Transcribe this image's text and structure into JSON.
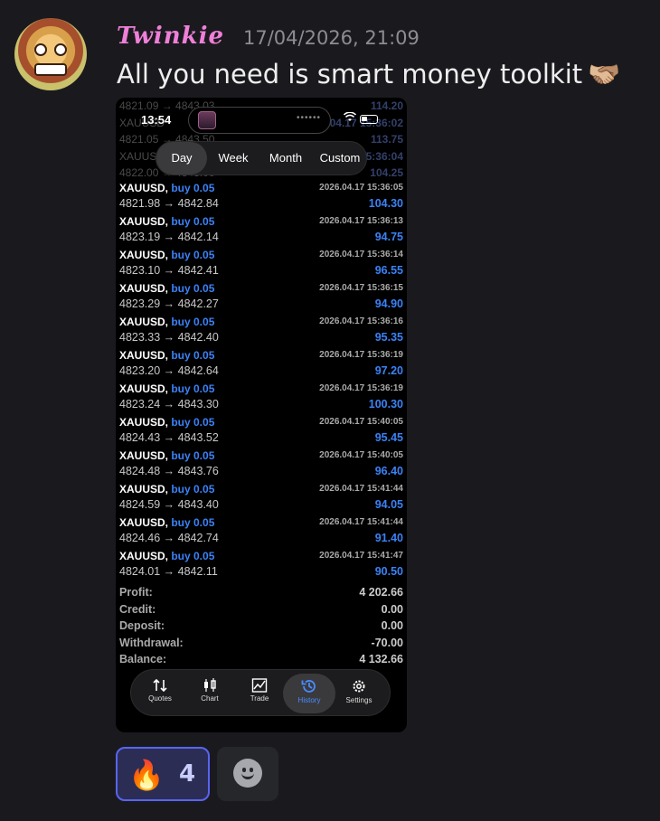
{
  "author": {
    "name": "Twinkie",
    "timestamp": "17/04/2026, 21:09"
  },
  "message": {
    "text": "All you need is smart money toolkit",
    "emoji": "🫱🏼‍🫲🏽"
  },
  "screenshot": {
    "clock": "13:54",
    "island_dots": "••••••",
    "ghost_rows": [
      {
        "text": "4821.09 → 4843.03",
        "value": "114.20"
      },
      {
        "text": "XAUUSD",
        "value": "2026.04.17 15:36:02"
      },
      {
        "text": "4821.05 → 4843.50",
        "value": "113.75"
      },
      {
        "text": "XAUUSD",
        "value": "2026.04.17 15:36:04"
      },
      {
        "text": "4822.00 → 4843.06",
        "value": "104.25"
      }
    ],
    "periods": [
      "Day",
      "Week",
      "Month",
      "Custom"
    ],
    "trades": [
      {
        "symbol": "XAUUSD,",
        "side": "buy 0.05",
        "date": "2026.04.17 15:36:05",
        "prices": "4821.98 → 4842.84",
        "profit": "104.30"
      },
      {
        "symbol": "XAUUSD,",
        "side": "buy 0.05",
        "date": "2026.04.17 15:36:13",
        "prices": "4823.19 → 4842.14",
        "profit": "94.75"
      },
      {
        "symbol": "XAUUSD,",
        "side": "buy 0.05",
        "date": "2026.04.17 15:36:14",
        "prices": "4823.10 → 4842.41",
        "profit": "96.55"
      },
      {
        "symbol": "XAUUSD,",
        "side": "buy 0.05",
        "date": "2026.04.17 15:36:15",
        "prices": "4823.29 → 4842.27",
        "profit": "94.90"
      },
      {
        "symbol": "XAUUSD,",
        "side": "buy 0.05",
        "date": "2026.04.17 15:36:16",
        "prices": "4823.33 → 4842.40",
        "profit": "95.35"
      },
      {
        "symbol": "XAUUSD,",
        "side": "buy 0.05",
        "date": "2026.04.17 15:36:19",
        "prices": "4823.20 → 4842.64",
        "profit": "97.20"
      },
      {
        "symbol": "XAUUSD,",
        "side": "buy 0.05",
        "date": "2026.04.17 15:36:19",
        "prices": "4823.24 → 4843.30",
        "profit": "100.30"
      },
      {
        "symbol": "XAUUSD,",
        "side": "buy 0.05",
        "date": "2026.04.17 15:40:05",
        "prices": "4824.43 → 4843.52",
        "profit": "95.45"
      },
      {
        "symbol": "XAUUSD,",
        "side": "buy 0.05",
        "date": "2026.04.17 15:40:05",
        "prices": "4824.48 → 4843.76",
        "profit": "96.40"
      },
      {
        "symbol": "XAUUSD,",
        "side": "buy 0.05",
        "date": "2026.04.17 15:41:44",
        "prices": "4824.59 → 4843.40",
        "profit": "94.05"
      },
      {
        "symbol": "XAUUSD,",
        "side": "buy 0.05",
        "date": "2026.04.17 15:41:44",
        "prices": "4824.46 → 4842.74",
        "profit": "91.40"
      },
      {
        "symbol": "XAUUSD,",
        "side": "buy 0.05",
        "date": "2026.04.17 15:41:47",
        "prices": "4824.01 → 4842.11",
        "profit": "90.50"
      }
    ],
    "summary": [
      {
        "label": "Profit:",
        "value": "4 202.66"
      },
      {
        "label": "Credit:",
        "value": "0.00"
      },
      {
        "label": "Deposit:",
        "value": "0.00"
      },
      {
        "label": "Withdrawal:",
        "value": "-70.00"
      },
      {
        "label": "Balance:",
        "value": "4 132.66"
      }
    ],
    "tabs": [
      {
        "label": "Quotes",
        "icon": "quotes-icon"
      },
      {
        "label": "Chart",
        "icon": "chart-icon"
      },
      {
        "label": "Trade",
        "icon": "trade-icon"
      },
      {
        "label": "History",
        "icon": "history-icon"
      },
      {
        "label": "Settings",
        "icon": "settings-icon"
      }
    ],
    "active_tab": "History",
    "active_period": "Day"
  },
  "reactions": [
    {
      "emoji": "🔥",
      "count": "4"
    }
  ],
  "colors": {
    "username": "#ef7fd8",
    "accent": "#3b82f6",
    "reaction_border": "#5865f2"
  }
}
